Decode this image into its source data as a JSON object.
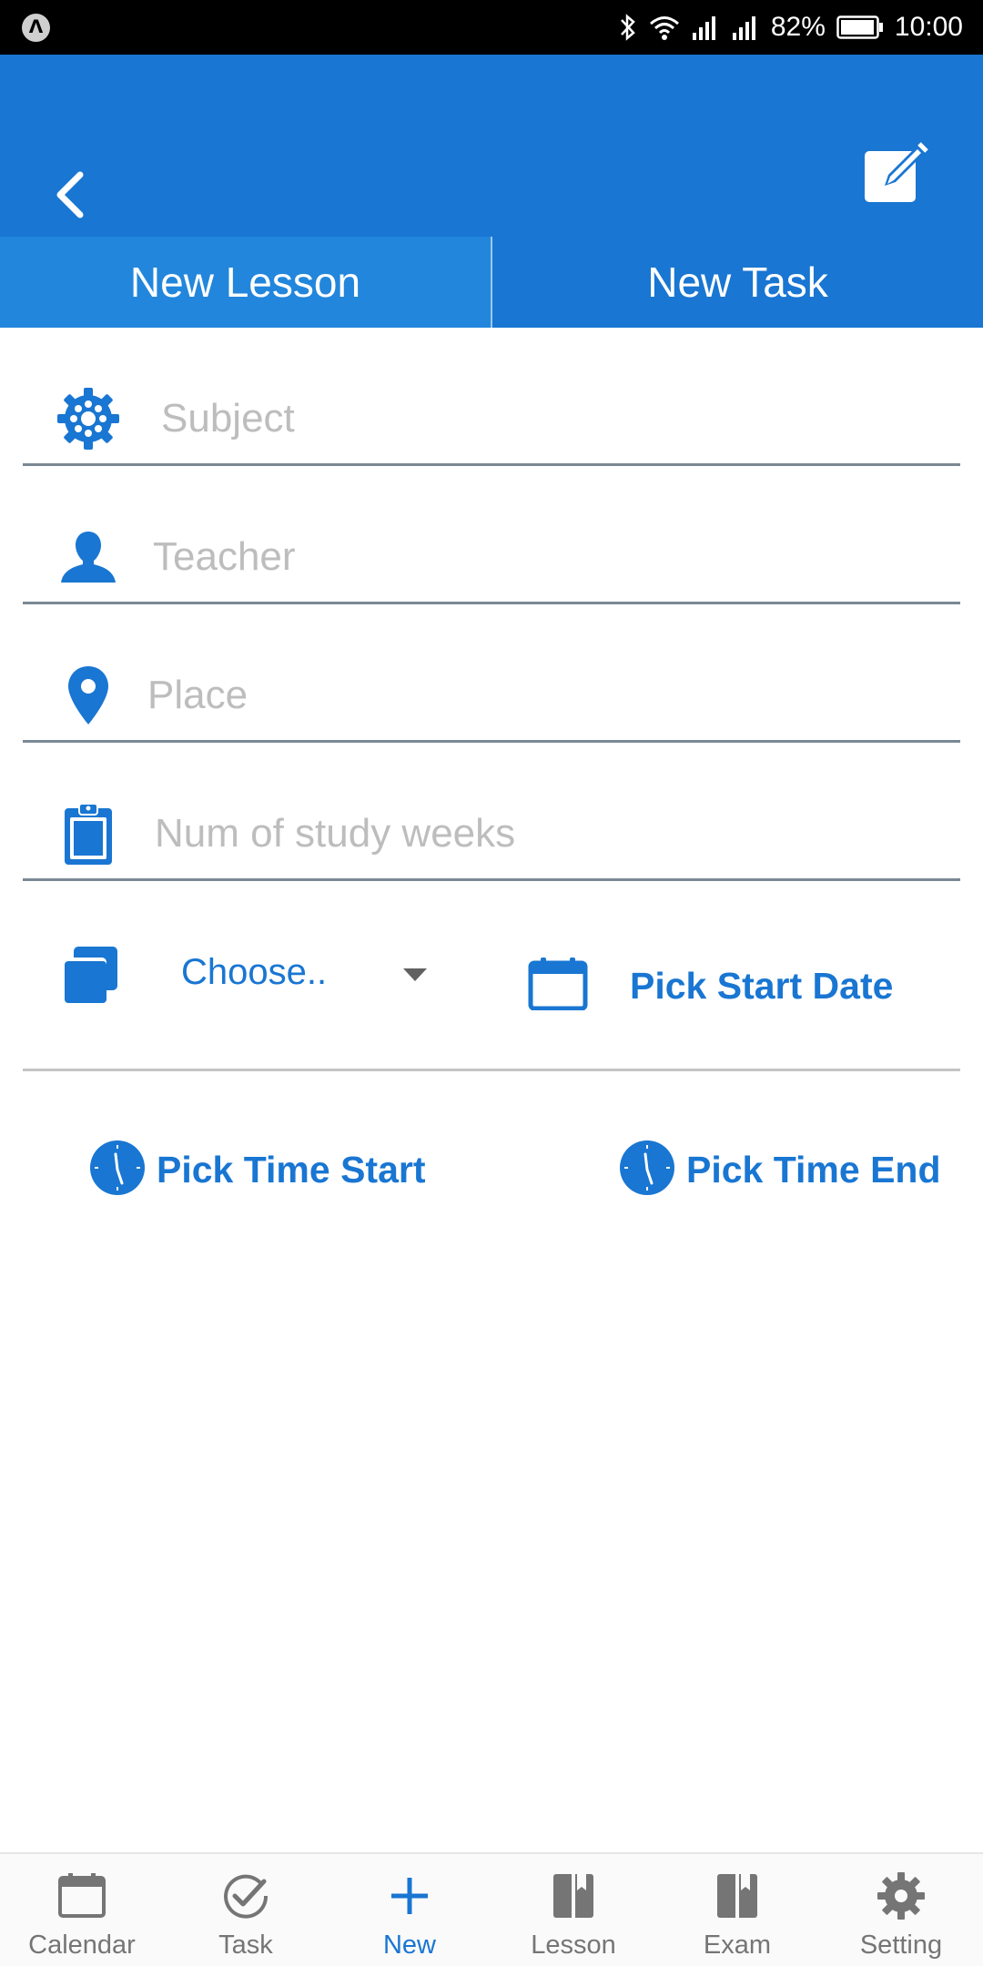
{
  "status_bar": {
    "battery": "82%",
    "time": "10:00"
  },
  "header": {
    "tabs": [
      {
        "label": "New Lesson",
        "active": true
      },
      {
        "label": "New Task",
        "active": false
      }
    ]
  },
  "form": {
    "subject": {
      "placeholder": "Subject",
      "value": "",
      "icon": "gear-icon"
    },
    "teacher": {
      "placeholder": "Teacher",
      "value": "",
      "icon": "person-icon"
    },
    "place": {
      "placeholder": "Place",
      "value": "",
      "icon": "location-pin-icon"
    },
    "weeks": {
      "placeholder": "Num of study weeks",
      "value": "",
      "icon": "clipboard-icon"
    },
    "choose": {
      "selected": "Choose..",
      "icon": "copy-icon"
    },
    "start_date": {
      "label": "Pick Start Date",
      "icon": "calendar-icon"
    },
    "time_start": {
      "label": "Pick Time Start",
      "icon": "clock-icon"
    },
    "time_end": {
      "label": "Pick Time End",
      "icon": "clock-icon"
    }
  },
  "bottom_nav": {
    "items": [
      {
        "label": "Calendar",
        "icon": "calendar-icon",
        "active": false
      },
      {
        "label": "Task",
        "icon": "check-circle-icon",
        "active": false
      },
      {
        "label": "New",
        "icon": "plus-icon",
        "active": true
      },
      {
        "label": "Lesson",
        "icon": "book-icon",
        "active": false
      },
      {
        "label": "Exam",
        "icon": "book-icon",
        "active": false
      },
      {
        "label": "Setting",
        "icon": "gear-icon",
        "active": false
      }
    ]
  },
  "colors": {
    "primary": "#1976d2",
    "tab_active": "#2286dc",
    "placeholder": "#bdbdbd",
    "nav_inactive": "#757575"
  }
}
